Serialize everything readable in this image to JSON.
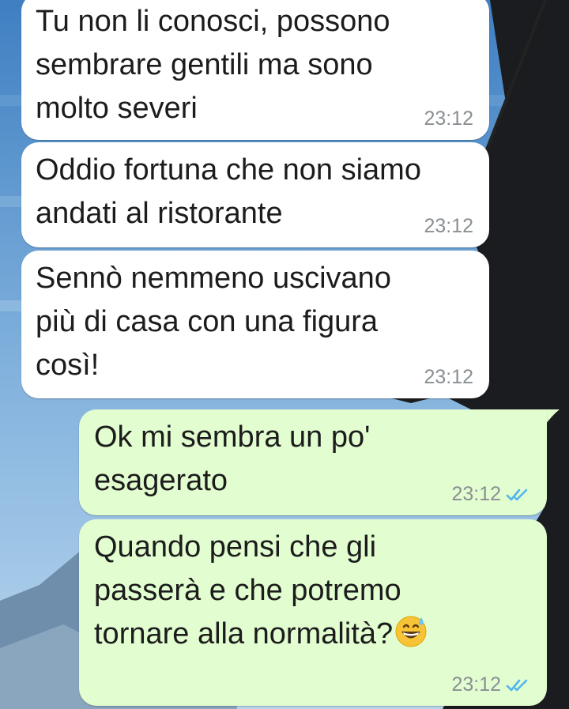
{
  "messages": [
    {
      "direction": "incoming",
      "text": "Tu non li conosci, possono\nsembrare gentili ma sono\nmolto severi",
      "time": "23:12"
    },
    {
      "direction": "incoming",
      "text": "Oddio fortuna che non siamo\nandati al ristorante",
      "time": "23:12"
    },
    {
      "direction": "incoming",
      "text": "Sennò nemmeno uscivano\npiù di casa con una figura\ncosì!",
      "time": "23:12"
    },
    {
      "direction": "outgoing",
      "text": "Ok mi sembra un po'\nesagerato",
      "time": "23:12",
      "status": "read"
    },
    {
      "direction": "outgoing",
      "text": "Quando pensi che gli\npasserà e che potremo\ntornare alla normalità?",
      "emoji": "grinning-face-with-sweat-emoji",
      "time": "23:12",
      "status": "read"
    }
  ],
  "colors": {
    "incoming_bubble": "#ffffff",
    "outgoing_bubble": "#e2fdd0",
    "read_ticks": "#4fb6ec",
    "timestamp": "#8a8f93"
  }
}
